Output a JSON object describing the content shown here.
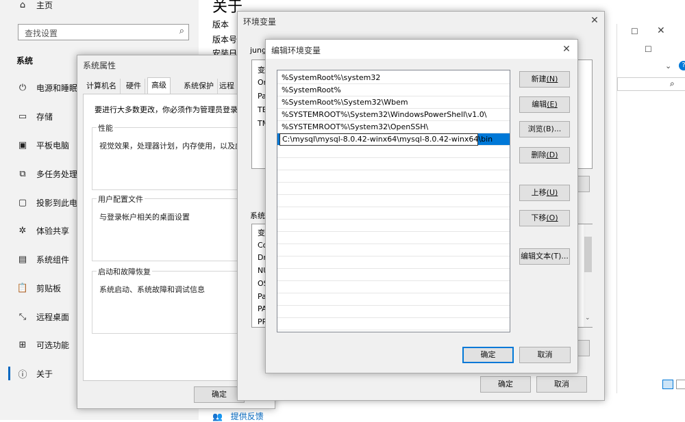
{
  "settings": {
    "home": "主页",
    "search_placeholder": "查找设置",
    "section": "系统",
    "nav": [
      {
        "label": "电源和睡眠",
        "icon": "power-icon"
      },
      {
        "label": "存储",
        "icon": "storage-icon"
      },
      {
        "label": "平板电脑",
        "icon": "tablet-icon"
      },
      {
        "label": "多任务处理",
        "icon": "multitask-icon"
      },
      {
        "label": "投影到此电",
        "icon": "project-icon"
      },
      {
        "label": "体验共享",
        "icon": "share-icon"
      },
      {
        "label": "系统组件",
        "icon": "components-icon"
      },
      {
        "label": "剪贴板",
        "icon": "clipboard-icon"
      },
      {
        "label": "远程桌面",
        "icon": "remote-icon"
      },
      {
        "label": "可选功能",
        "icon": "optional-icon"
      },
      {
        "label": "关于",
        "icon": "info-icon"
      }
    ],
    "about_title": "关于",
    "about_lines": [
      "版本",
      "版本号",
      "安装日"
    ],
    "feedback": "提供反馈"
  },
  "sysprops": {
    "title": "系统属性",
    "tabs": [
      "计算机名",
      "硬件",
      "高级",
      "系统保护",
      "远程"
    ],
    "active_tab": 2,
    "admin_note": "要进行大多数更改，你必须作为管理员登录。",
    "groups": [
      {
        "title": "性能",
        "text": "视觉效果，处理器计划，内存使用，以及虚拟"
      },
      {
        "title": "用户配置文件",
        "text": "与登录帐户相关的桌面设置"
      },
      {
        "title": "启动和故障恢复",
        "text": "系统启动、系统故障和调试信息"
      }
    ],
    "ok": "确定"
  },
  "envvars": {
    "title": "环境变量",
    "user_label": "jung",
    "user_rows": [
      "变",
      "On",
      "Pa",
      "TE",
      "TM"
    ],
    "sys_label": "系统",
    "sys_rows": [
      "变",
      "Co",
      "Dr",
      "NU",
      "OS",
      "Pa",
      "PA",
      "PR"
    ],
    "ok": "确定",
    "cancel": "取消"
  },
  "editenv": {
    "title": "编辑环境变量",
    "paths": [
      "%SystemRoot%\\system32",
      "%SystemRoot%",
      "%SystemRoot%\\System32\\Wbem",
      "%SYSTEMROOT%\\System32\\WindowsPowerShell\\v1.0\\",
      "%SYSTEMROOT%\\System32\\OpenSSH\\",
      "C:\\mysql\\mysql-8.0.42-winx64\\mysql-8.0.42-winx64\\bin"
    ],
    "buttons": {
      "new": "新建",
      "new_key": "(N)",
      "edit": "编辑",
      "edit_key": "(E)",
      "browse": "浏览",
      "browse_key": "(B)...",
      "delete": "删除",
      "delete_key": "(D)",
      "up": "上移",
      "up_key": "(U)",
      "down": "下移",
      "down_key": "(O)",
      "edit_text": "编辑文本",
      "edit_text_key": "(T)..."
    },
    "ok": "确定",
    "cancel": "取消"
  },
  "colors": {
    "accent": "#0078d7",
    "dialog_bg": "#f0f0f0"
  }
}
